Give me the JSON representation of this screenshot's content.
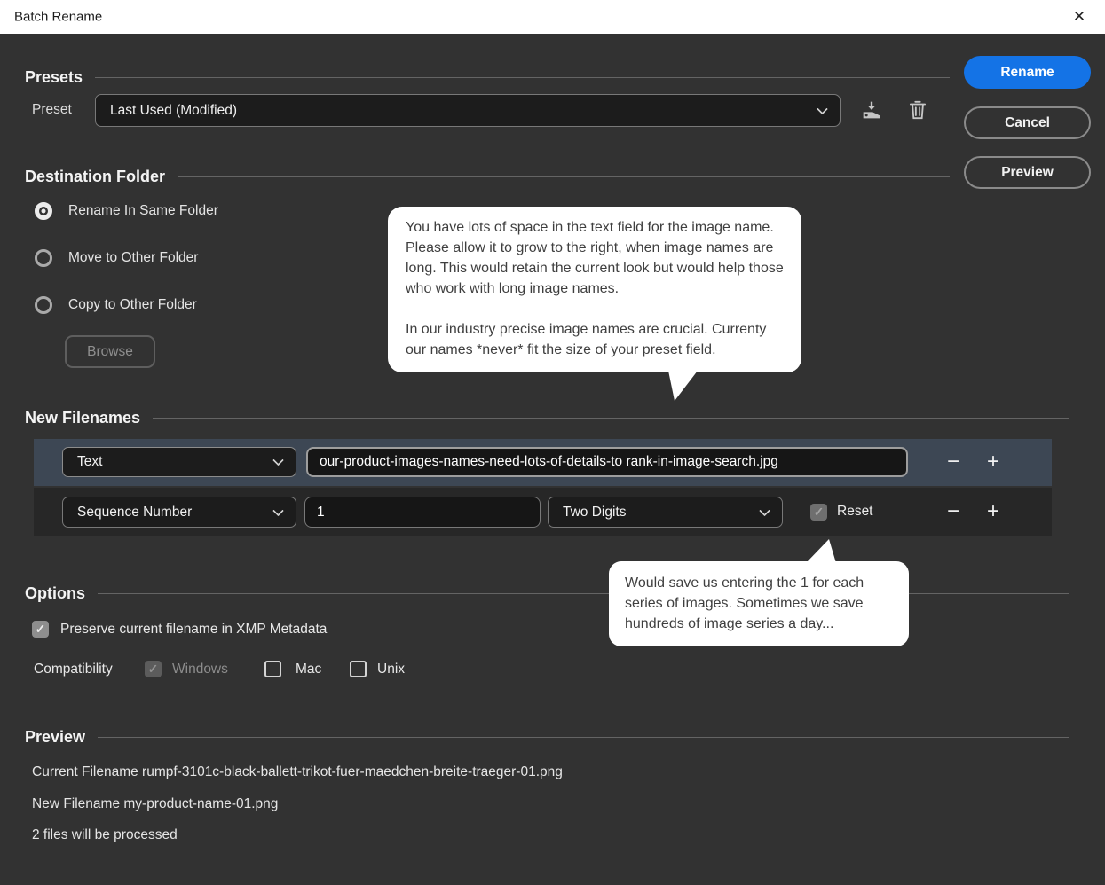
{
  "window": {
    "title": "Batch Rename",
    "close_glyph": "✕"
  },
  "buttons": {
    "rename": "Rename",
    "cancel": "Cancel",
    "preview": "Preview"
  },
  "presets": {
    "title": "Presets",
    "label": "Preset",
    "value": "Last Used (Modified)"
  },
  "destination": {
    "title": "Destination Folder",
    "radios": [
      {
        "label": "Rename In Same Folder",
        "selected": true
      },
      {
        "label": "Move to Other Folder",
        "selected": false
      },
      {
        "label": "Copy to Other Folder",
        "selected": false
      }
    ],
    "browse": "Browse"
  },
  "new_filenames": {
    "title": "New Filenames",
    "row1": {
      "type": "Text",
      "value": "our-product-images-names-need-lots-of-details-to rank-in-image-search.jpg"
    },
    "row2": {
      "type": "Sequence Number",
      "value": "1",
      "digits": "Two Digits",
      "reset_label": "Reset",
      "reset_checked": true
    }
  },
  "options": {
    "title": "Options",
    "preserve_label": "Preserve current filename in XMP Metadata",
    "preserve_checked": true,
    "compatibility_label": "Compatibility",
    "windows_label": "Windows",
    "windows_checked": true,
    "windows_disabled": true,
    "mac_label": "Mac",
    "mac_checked": false,
    "unix_label": "Unix",
    "unix_checked": false
  },
  "preview": {
    "title": "Preview",
    "current_line": "Current Filename rumpf-3101c-black-ballett-trikot-fuer-maedchen-breite-traeger-01.png",
    "new_line": "New Filename my-product-name-01.png",
    "count_line": "2 files will be processed"
  },
  "callouts": {
    "textfield": {
      "p1": "You have lots of space in the text field for the image name. Please allow it to grow to the right, when image names are long. This would retain the current look but would help those who work with long image names.",
      "p2": "In our industry precise image names are crucial. Currenty our names *never* fit the size of your preset field."
    },
    "sequence": {
      "text": "Would save us entering the 1 for each series of images. Sometimes we save hundreds of image series a day..."
    }
  },
  "glyphs": {
    "minus": "−",
    "plus": "+",
    "check": "✓"
  },
  "colors": {
    "accent": "#1473E6",
    "dialog_bg": "#323232",
    "selected_row_bg": "#3d4754",
    "bubble_bg": "#ffffff"
  }
}
